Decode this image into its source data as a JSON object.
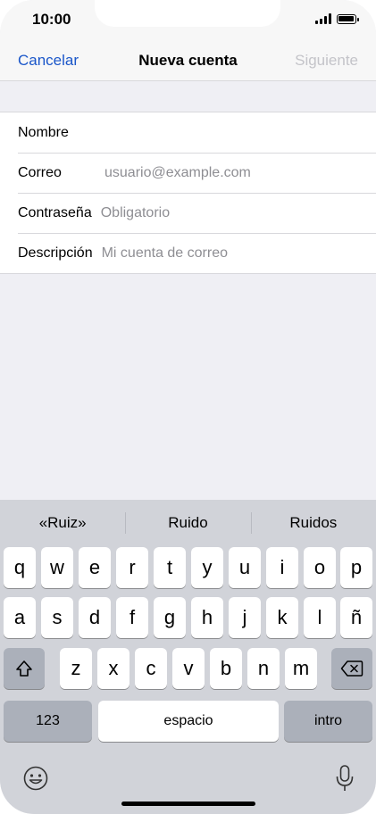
{
  "status_bar": {
    "time": "10:00"
  },
  "nav": {
    "cancel": "Cancelar",
    "title": "Nueva cuenta",
    "next": "Siguiente"
  },
  "form": {
    "rows": [
      {
        "label": "Nombre",
        "placeholder": "",
        "value": ""
      },
      {
        "label": "Correo",
        "placeholder": "usuario@example.com",
        "value": ""
      },
      {
        "label": "Contraseña",
        "placeholder": "Obligatorio",
        "value": ""
      },
      {
        "label": "Descripción",
        "placeholder": "Mi cuenta de correo",
        "value": ""
      }
    ]
  },
  "keyboard": {
    "suggestions": [
      "«Ruiz»",
      "Ruido",
      "Ruidos"
    ],
    "row1": [
      "q",
      "w",
      "e",
      "r",
      "t",
      "y",
      "u",
      "i",
      "o",
      "p"
    ],
    "row2": [
      "a",
      "s",
      "d",
      "f",
      "g",
      "h",
      "j",
      "k",
      "l",
      "ñ"
    ],
    "row3": [
      "z",
      "x",
      "c",
      "v",
      "b",
      "n",
      "m"
    ],
    "numbers_key": "123",
    "space_key": "espacio",
    "return_key": "intro"
  },
  "icons": {
    "shift": "shift-arrow-icon",
    "delete": "backspace-icon",
    "emoji": "emoji-smiley-icon",
    "mic": "microphone-icon"
  }
}
